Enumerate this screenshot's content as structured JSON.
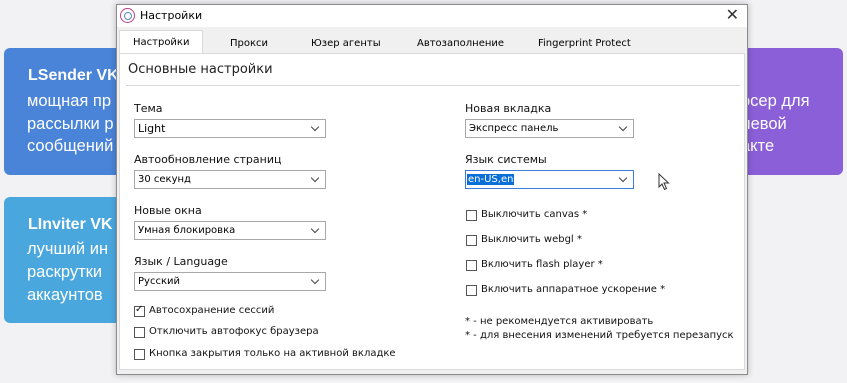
{
  "background": {
    "card_lsender": {
      "title": "LSender VK",
      "lines": [
        "мощная пр",
        "рассылки р",
        "сообщений"
      ]
    },
    "card_linviter": {
      "title": "LInviter VK",
      "lines": [
        "лучший ин",
        "раскрутки",
        "аккаунтов"
      ]
    },
    "card_right": {
      "lines": [
        "осер для",
        "левой",
        "акте"
      ]
    }
  },
  "window": {
    "title": "Настройки",
    "close_label": "✕",
    "tabs": [
      {
        "label": "Настройки",
        "active": true
      },
      {
        "label": "Прокси",
        "active": false
      },
      {
        "label": "Юзер агенты",
        "active": false
      },
      {
        "label": "Автозаполнение",
        "active": false
      },
      {
        "label": "Fingerprint Protect",
        "active": false
      }
    ],
    "section_title": "Основные настройки",
    "left": {
      "theme": {
        "label": "Тема",
        "value": "Light"
      },
      "autorefresh": {
        "label": "Автообновление страниц",
        "value": "30 секунд"
      },
      "new_windows": {
        "label": "Новые окна",
        "value": "Умная блокировка"
      },
      "language": {
        "label": "Язык / Language",
        "value": "Русский"
      },
      "checkboxes": [
        {
          "label": "Автосохранение сессий",
          "checked": true
        },
        {
          "label": "Отключить автофокус браузера",
          "checked": false
        },
        {
          "label": "Кнопка закрытия только на активной вкладке",
          "checked": false
        }
      ]
    },
    "right": {
      "new_tab": {
        "label": "Новая вкладка",
        "value": "Экспресс панель"
      },
      "system_language": {
        "label": "Язык системы",
        "value": "en-US,en"
      },
      "checkboxes": [
        {
          "label": "Выключить canvas *",
          "checked": false
        },
        {
          "label": "Выключить webgl *",
          "checked": false
        },
        {
          "label": "Включить flash player *",
          "checked": false
        },
        {
          "label": "Включить аппаратное ускорение *",
          "checked": false
        }
      ],
      "notes": [
        "* - не рекомендуется активировать",
        "* - для внесения изменений требуется перезапуск"
      ]
    }
  },
  "colors": {
    "lsender_card": "#4a84d8",
    "linviter_card": "#4aa7de",
    "right_card": "#8a5fd8",
    "selection": "#0a6fd6"
  }
}
